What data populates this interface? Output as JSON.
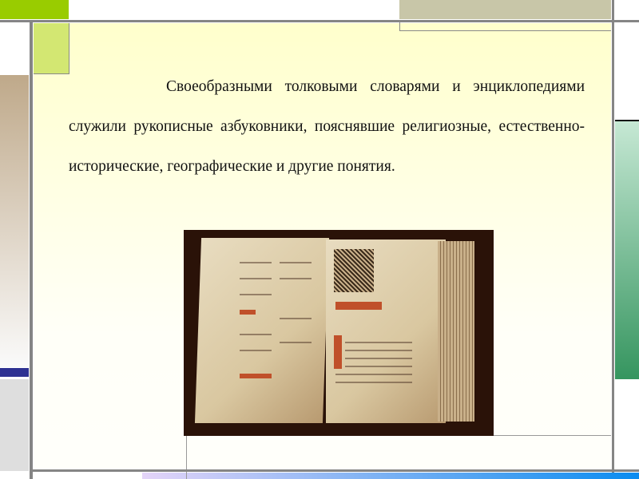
{
  "slide": {
    "paragraph": "Своеобразными толковыми словарями и энциклопедиями служили рукописные азбуковники, пояснявшие религиозные, естественно-исторические, географические и другие понятия."
  },
  "image": {
    "alt": "open-manuscript-book"
  },
  "colors": {
    "accent_green": "#99cc00",
    "tan": "#c8c6a8",
    "blue": "#2e3192",
    "green_bar": "#3a9a68"
  }
}
